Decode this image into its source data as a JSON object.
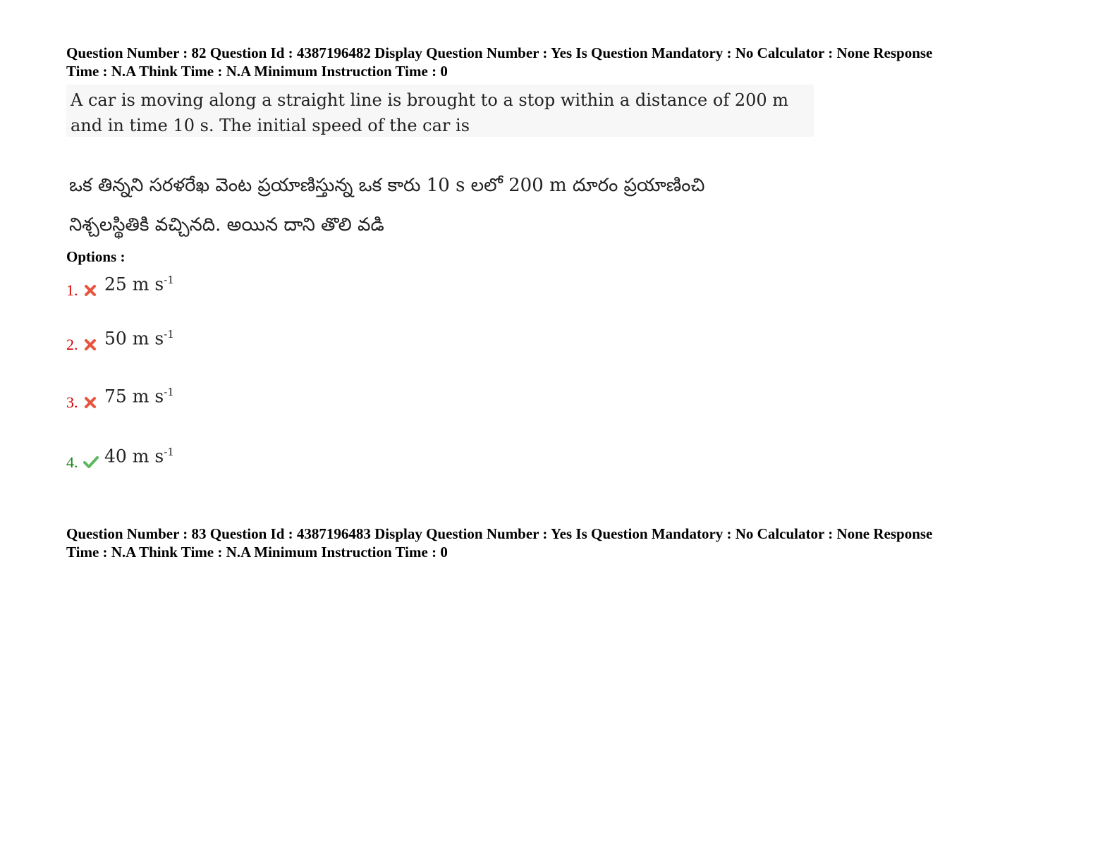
{
  "question_82": {
    "header_line1": "Question Number : 82 Question Id : 4387196482 Display Question Number : Yes Is Question Mandatory : No Calculator : None Response",
    "header_line2": "Time : N.A Think Time : N.A Minimum Instruction Time : 0",
    "text_en_line1": "A car is moving along a straight line is brought to a stop within a distance of 200  m",
    "text_en_line2": "and in time 10 s.  The initial speed of the car is",
    "text_te_line1": "ఒక తిన్నని సరళరేఖ వెంట ప్రయాణిస్తున్న ఒక కారు 10 s లలో 200 m దూరం ప్రయాణించి",
    "text_te_line2": "నిశ్చలస్థితికి వచ్చినది. అయిన దాని తొలి వడి",
    "options_label": "Options :",
    "options": [
      {
        "number": "1.",
        "value": "25 m s",
        "exp": "-1",
        "status": "wrong",
        "status_icon": "cross-icon"
      },
      {
        "number": "2.",
        "value": "50 m s",
        "exp": "-1",
        "status": "wrong",
        "status_icon": "cross-icon"
      },
      {
        "number": "3.",
        "value": "75 m s",
        "exp": "-1",
        "status": "wrong",
        "status_icon": "cross-icon"
      },
      {
        "number": "4.",
        "value": "40 m s",
        "exp": "-1",
        "status": "correct",
        "status_icon": "check-icon"
      }
    ]
  },
  "question_83": {
    "header_line1": "Question Number : 83 Question Id : 4387196483 Display Question Number : Yes Is Question Mandatory : No Calculator : None Response",
    "header_line2": "Time : N.A Think Time : N.A Minimum Instruction Time : 0"
  },
  "colors": {
    "wrong": "#d40000",
    "correct": "#1a8a1a",
    "cross_icon": "#e8553f",
    "check_icon": "#5cb85c"
  }
}
